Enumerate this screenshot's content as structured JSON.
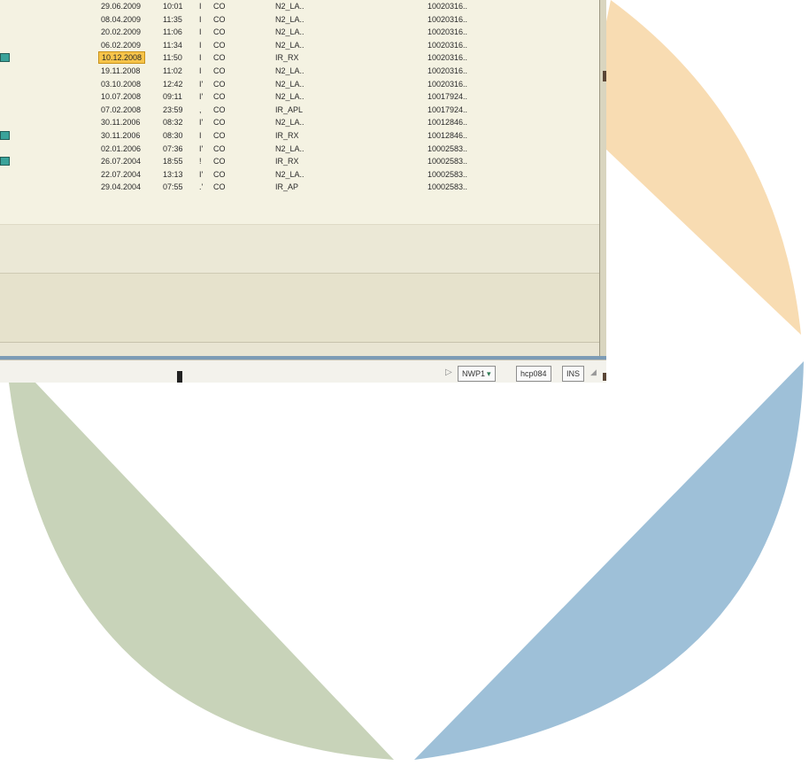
{
  "colors": {
    "peach": "#f8dcb2",
    "sage": "#c8d3b9",
    "blue": "#9ec0d8",
    "highlight": "#f7c44a"
  },
  "rows": [
    {
      "date": "29.06.2009",
      "time": "10:01",
      "flag": "I",
      "org": "CO",
      "type": "N2_LA..",
      "num": "10020316..",
      "icon": false,
      "highlight": false
    },
    {
      "date": "08.04.2009",
      "time": "11:35",
      "flag": "I",
      "org": "CO",
      "type": "N2_LA..",
      "num": "10020316..",
      "icon": false,
      "highlight": false
    },
    {
      "date": "20.02.2009",
      "time": "11:06",
      "flag": "I",
      "org": "CO",
      "type": "N2_LA..",
      "num": "10020316..",
      "icon": false,
      "highlight": false
    },
    {
      "date": "06.02.2009",
      "time": "11:34",
      "flag": "I",
      "org": "CO",
      "type": "N2_LA..",
      "num": "10020316..",
      "icon": false,
      "highlight": false
    },
    {
      "date": "10.12.2008",
      "time": "11:50",
      "flag": "I",
      "org": "CO",
      "type": "IR_RX",
      "num": "10020316..",
      "icon": true,
      "highlight": true
    },
    {
      "date": "19.11.2008",
      "time": "11:02",
      "flag": "I",
      "org": "CO",
      "type": "N2_LA..",
      "num": "10020316..",
      "icon": false,
      "highlight": false
    },
    {
      "date": "03.10.2008",
      "time": "12:42",
      "flag": "I'",
      "org": "CO",
      "type": "N2_LA..",
      "num": "10020316..",
      "icon": false,
      "highlight": false
    },
    {
      "date": "10.07.2008",
      "time": "09:11",
      "flag": "I'",
      "org": "CO",
      "type": "N2_LA..",
      "num": "10017924..",
      "icon": false,
      "highlight": false
    },
    {
      "date": "07.02.2008",
      "time": "23:59",
      "flag": ",",
      "org": "CO",
      "type": "IR_APL",
      "num": "10017924..",
      "icon": false,
      "highlight": false
    },
    {
      "date": "30.11.2006",
      "time": "08:32",
      "flag": "I'",
      "org": "CO",
      "type": "N2_LA..",
      "num": "10012846..",
      "icon": false,
      "highlight": false
    },
    {
      "date": "30.11.2006",
      "time": "08:30",
      "flag": "I",
      "org": "CO",
      "type": "IR_RX",
      "num": "10012846..",
      "icon": true,
      "highlight": false
    },
    {
      "date": "02.01.2006",
      "time": "07:36",
      "flag": "I'",
      "org": "CO",
      "type": "N2_LA..",
      "num": "10002583..",
      "icon": false,
      "highlight": false
    },
    {
      "date": "26.07.2004",
      "time": "18:55",
      "flag": "!",
      "org": "CO",
      "type": "IR_RX",
      "num": "10002583..",
      "icon": true,
      "highlight": false
    },
    {
      "date": "22.07.2004",
      "time": "13:13",
      "flag": "I'",
      "org": "CO",
      "type": "N2_LA..",
      "num": "10002583..",
      "icon": false,
      "highlight": false
    },
    {
      "date": "29.04.2004",
      "time": "07:55",
      "flag": ".'",
      "org": "CO",
      "type": "IR_AP",
      "num": "10002583..",
      "icon": false,
      "highlight": false
    }
  ],
  "statusbar": {
    "arrow": "▷",
    "system": "NWP1",
    "server": "hcp084",
    "mode": "INS"
  }
}
